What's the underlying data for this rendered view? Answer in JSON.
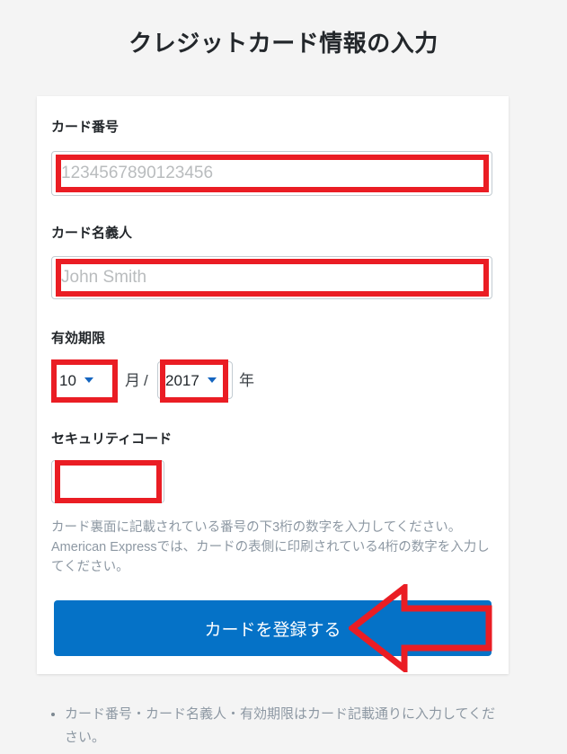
{
  "page": {
    "title": "クレジットカード情報の入力",
    "background_color": "#f4f4f4",
    "panel_color": "#ffffff"
  },
  "form": {
    "card_number": {
      "label": "カード番号",
      "placeholder": "1234567890123456",
      "value": ""
    },
    "card_holder": {
      "label": "カード名義人",
      "placeholder": "John Smith",
      "value": ""
    },
    "expiry": {
      "label": "有効期限",
      "month_value": "10",
      "month_unit": "月",
      "separator": "/",
      "year_value": "2017",
      "year_unit": "年"
    },
    "security_code": {
      "label": "セキュリティコード",
      "placeholder": "",
      "value": "",
      "helper_text": "カード裏面に記載されている番号の下3桁の数字を入力してください。American Expressでは、カードの表側に印刷されている4桁の数字を入力してください。"
    },
    "submit": {
      "label": "カードを登録する",
      "color": "#0572c7"
    }
  },
  "footer": {
    "notes": [
      "カード番号・カード名義人・有効期限はカード記載通りに入力してください。"
    ]
  },
  "annotations": {
    "color": "#ea1d24",
    "highlighted_fields": [
      "card-number",
      "card-holder",
      "expiry-month",
      "expiry-year",
      "security-code"
    ],
    "arrow": {
      "direction": "left",
      "points_to": "カードを登録する"
    }
  }
}
